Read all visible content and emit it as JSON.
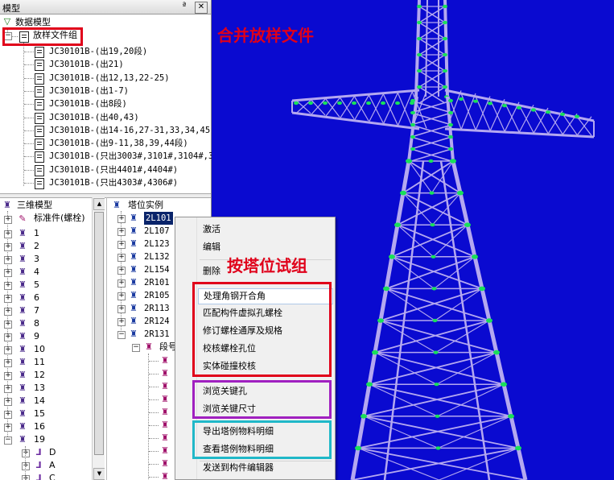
{
  "panel_title": "模型",
  "title_pin": "ª",
  "title_close": "✕",
  "data_model_label": "数据模型",
  "group_label": "放样文件组",
  "files": [
    "JC30101B-(出19,20段)",
    "JC30101B-(出21)",
    "JC30101B-(出12,13,22-25)",
    "JC30101B-(出1-7)",
    "JC30101B-(出8段)",
    "JC30101B-(出40,43)",
    "JC30101B-(出14-16,27-31,33,34,45)",
    "JC30101B-(出9-11,38,39,44段)",
    "JC30101B-(只出3003#,3101#,3104#,3",
    "JC30101B-(只出4401#,4404#)",
    "JC30101B-(只出4303#,4306#)"
  ],
  "model3d": {
    "root": "三维模型",
    "standard": "标准件(螺栓)",
    "segments": [
      "1",
      "2",
      "3",
      "4",
      "5",
      "6",
      "7",
      "8",
      "9",
      "10",
      "11",
      "12",
      "13",
      "14",
      "15",
      "16",
      "19"
    ],
    "sub19": [
      "D",
      "A",
      "C"
    ]
  },
  "instances": {
    "root": "塔位实例",
    "items": [
      "2L101",
      "2L107",
      "2L123",
      "2L132",
      "2L154",
      "2R101",
      "2R105",
      "2R113",
      "2R124",
      "2R131"
    ],
    "child": "段号"
  },
  "context_menu": {
    "group1": [
      "激活",
      "编辑"
    ],
    "delete": "删除",
    "group2": [
      "处理角钢开合角",
      "匹配构件虚拟孔螺栓",
      "修订螺栓通厚及规格",
      "校核螺栓孔位",
      "实体碰撞校核"
    ],
    "group3": [
      "浏览关键孔",
      "浏览关键尺寸"
    ],
    "group4": [
      "导出塔例物料明细",
      "查看塔例物料明细"
    ],
    "last": "发送到构件编辑器"
  },
  "annotations": {
    "merge": "合并放样文件",
    "trial": "按塔位试组"
  },
  "colors": {
    "viewport_bg": "#0a0ad0",
    "tower": "#b4a8f0",
    "joints": "#19e05a",
    "red": "#e0001a",
    "purple": "#a020c0",
    "cyan": "#20b8c8",
    "selection": "#0a246a"
  }
}
